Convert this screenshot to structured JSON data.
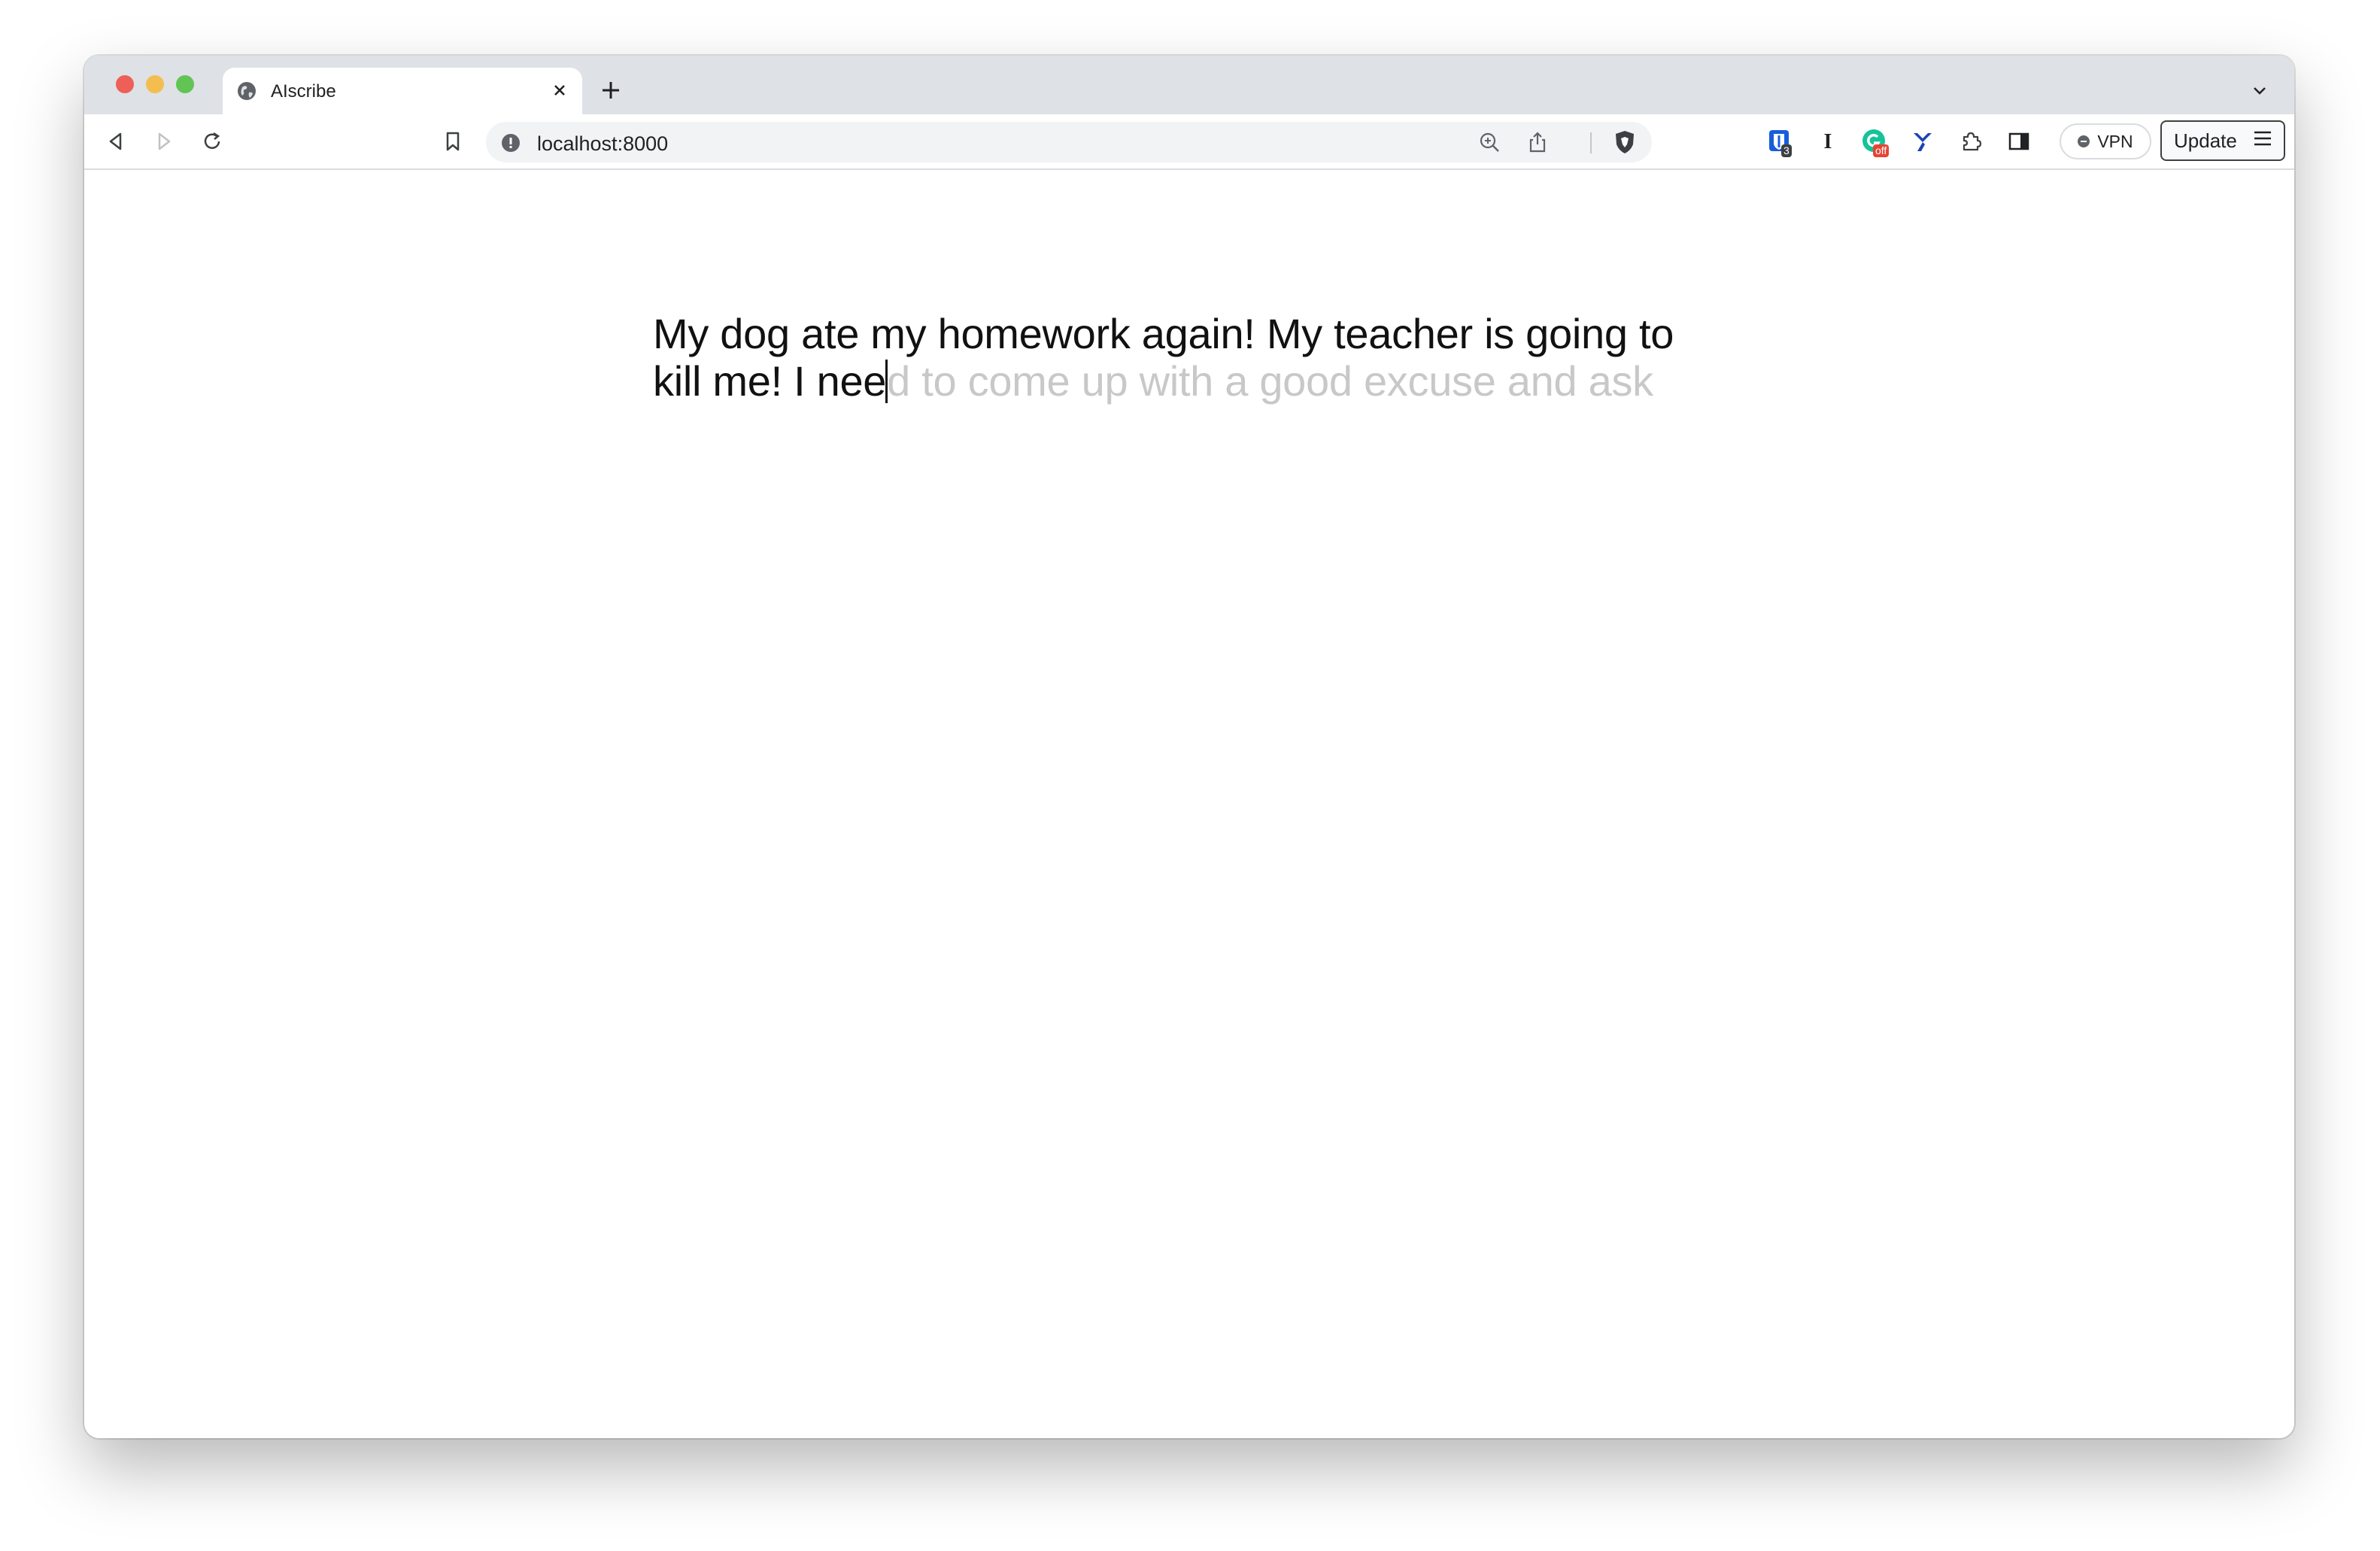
{
  "browser": {
    "tab": {
      "title": "AIscribe"
    },
    "address_bar": {
      "url": "localhost:8000"
    },
    "extensions": {
      "badge_count": "3",
      "grammarly_badge": "off"
    },
    "vpn_label": "VPN",
    "update_label": "Update"
  },
  "editor": {
    "typed_line1": "My dog ate my homework again! My teacher is going to",
    "typed_line2": "kill me! I nee",
    "suggestion": "d to come up with a good excuse and ask"
  },
  "colors": {
    "suggestion_text": "#c8c8c8",
    "typed_text": "#111111"
  }
}
